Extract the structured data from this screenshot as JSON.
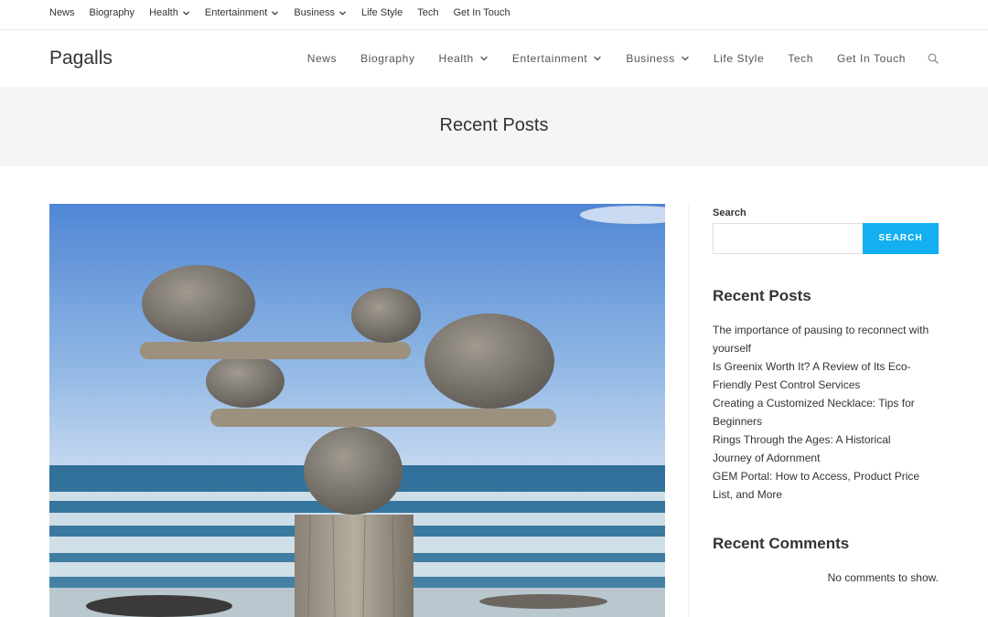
{
  "topbar": {
    "items": [
      {
        "label": "News",
        "has_dropdown": false
      },
      {
        "label": "Biography",
        "has_dropdown": false
      },
      {
        "label": "Health",
        "has_dropdown": true
      },
      {
        "label": "Entertainment",
        "has_dropdown": true
      },
      {
        "label": "Business",
        "has_dropdown": true
      },
      {
        "label": "Life Style",
        "has_dropdown": false
      },
      {
        "label": "Tech",
        "has_dropdown": false
      },
      {
        "label": "Get In Touch",
        "has_dropdown": false
      }
    ]
  },
  "header": {
    "logo": "Pagalls",
    "nav": [
      {
        "label": "News",
        "has_dropdown": false
      },
      {
        "label": "Biography",
        "has_dropdown": false
      },
      {
        "label": "Health",
        "has_dropdown": true
      },
      {
        "label": "Entertainment",
        "has_dropdown": true
      },
      {
        "label": "Business",
        "has_dropdown": true
      },
      {
        "label": "Life Style",
        "has_dropdown": false
      },
      {
        "label": "Tech",
        "has_dropdown": false
      },
      {
        "label": "Get In Touch",
        "has_dropdown": false
      }
    ],
    "search_icon": "search-icon"
  },
  "page": {
    "title": "Recent Posts"
  },
  "featured_image": {
    "subject": "balanced-stones-image"
  },
  "sidebar": {
    "search": {
      "label": "Search",
      "placeholder": "",
      "value": "",
      "button_label": "SEARCH"
    },
    "recent_posts": {
      "title": "Recent Posts",
      "items": [
        "The importance of pausing to reconnect with yourself",
        "Is Greenix Worth It? A Review of Its Eco-Friendly Pest Control Services",
        "Creating a Customized Necklace: Tips for Beginners",
        "Rings Through the Ages: A Historical Journey of Adornment",
        "GEM Portal: How to Access, Product Price List, and More"
      ]
    },
    "recent_comments": {
      "title": "Recent Comments",
      "empty_text": "No comments to show."
    }
  },
  "colors": {
    "accent": "#13aff0",
    "page_header_bg": "#f5f5f5",
    "text": "#333333"
  }
}
